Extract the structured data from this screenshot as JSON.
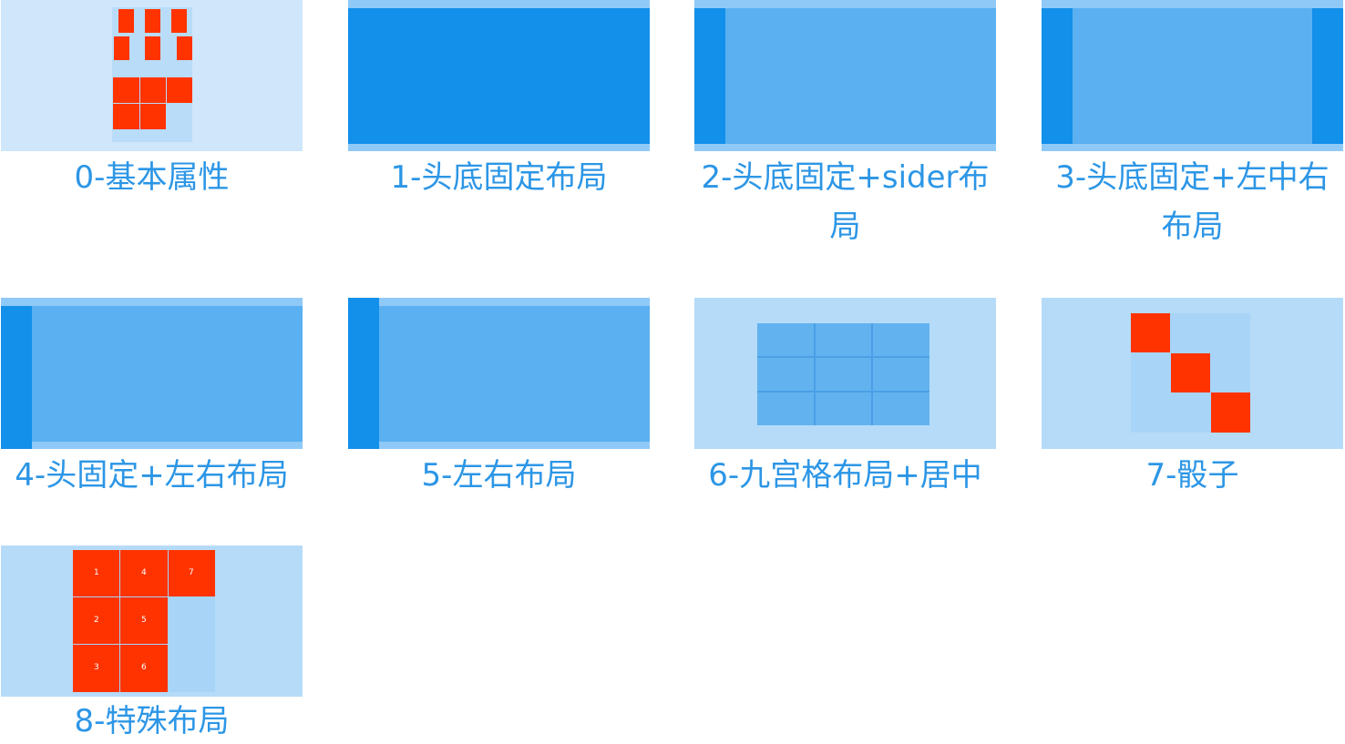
{
  "cards": [
    {
      "label": "0-基本属性"
    },
    {
      "label": "1-头底固定布局"
    },
    {
      "label": "2-头底固定+sider布局"
    },
    {
      "label": "3-头底固定+左中右布局"
    },
    {
      "label": "4-头固定+左右布局"
    },
    {
      "label": "5-左右布局"
    },
    {
      "label": "6-九宫格布局+居中"
    },
    {
      "label": "7-骰子"
    },
    {
      "label": "8-特殊布局"
    }
  ],
  "special_layout_cells": [
    "1",
    "2",
    "3",
    "4",
    "5",
    "6",
    "7"
  ],
  "colors": {
    "caption": "#2c96e6",
    "accent_red": "#ff3300",
    "primary_blue": "#1290ea",
    "mid_blue": "#5ab0f0",
    "light_blue": "#8fc9f7",
    "pale_blue": "#b5dbf8"
  }
}
